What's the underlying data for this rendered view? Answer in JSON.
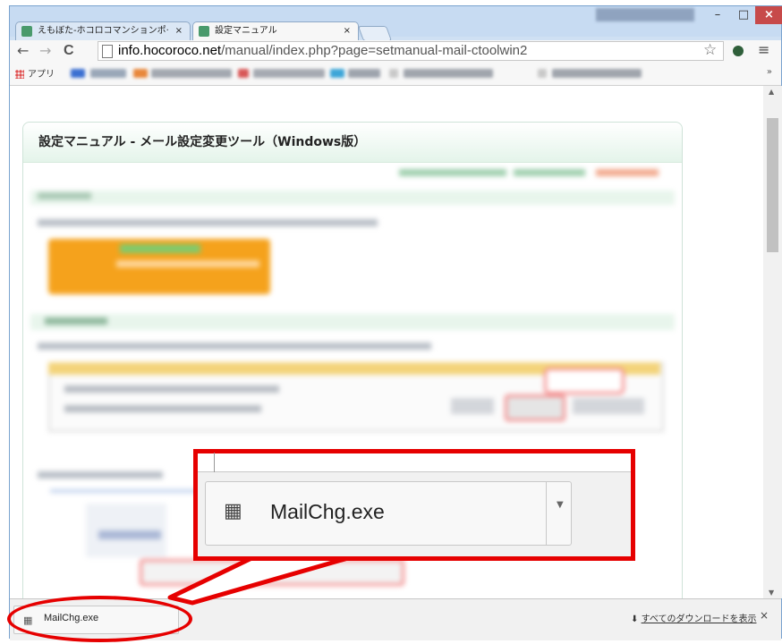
{
  "tabs": [
    {
      "title": "えもぼた-ホコロコマンションポ·"
    },
    {
      "title": "設定マニュアル"
    }
  ],
  "tab_close_glyph": "×",
  "window_buttons": {
    "minimize": "–",
    "maximize": "□",
    "close": "×"
  },
  "toolbar": {
    "back_glyph": "←",
    "forward_glyph": "→",
    "reload_glyph": "C",
    "url_host": "info.hocoroco.net",
    "url_path": "/manual/index.php?page=setmanual-mail-ctoolwin2",
    "star_glyph": "☆",
    "menu_glyph": "≡"
  },
  "bookmarks": {
    "apps_label": "アプリ",
    "more_glyph": "»"
  },
  "page": {
    "heading": "設定マニュアル  -  メール設定変更ツール（Windows版）"
  },
  "download_bar": {
    "file_name": "MailChg.exe",
    "show_all_label": "すべてのダウンロードを表示",
    "show_all_icon_glyph": "⬇",
    "close_glyph": "×",
    "dropdown_glyph": "▼"
  },
  "icons": {
    "file": "exe-file-icon",
    "download": "download-arrow-icon"
  },
  "colors": {
    "callout": "#e60000",
    "card_header": "#e4f4ea",
    "download_button": "#f5a21c",
    "close_button": "#c74a4a"
  }
}
